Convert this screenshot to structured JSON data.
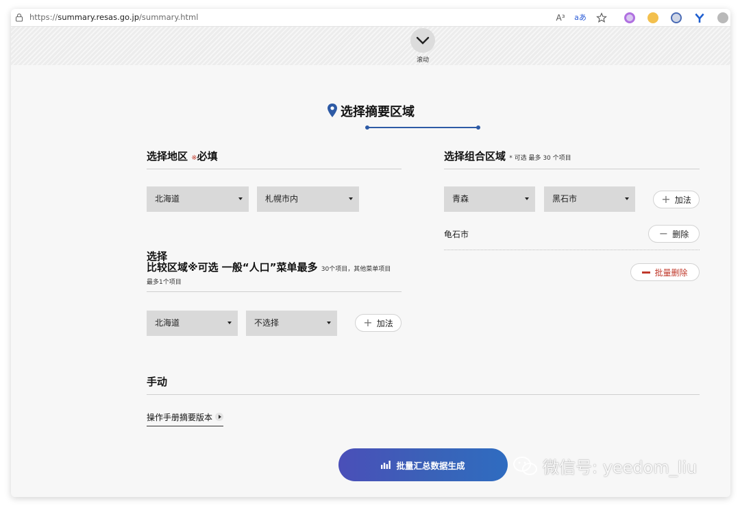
{
  "browser": {
    "url_prefix": "https://",
    "url_host": "summary.resas.go.jp",
    "url_path": "/summary.html",
    "read_aloud_icon": "A³",
    "translate_icon": "aあ"
  },
  "scroll": {
    "label": "滚动"
  },
  "page_title": "选择摘要区域",
  "region": {
    "heading": "选择地区",
    "required_mark": "※",
    "required": "必填",
    "prefecture": "北海道",
    "city": "札幌市内"
  },
  "combo": {
    "heading": "选择组合区域",
    "note": "* 可选 最多 30 个项目",
    "prefecture": "青森",
    "city": "黑石市",
    "add_label": "加法",
    "items": [
      {
        "name": "龟石市",
        "delete_label": "删除"
      }
    ],
    "bulk_delete_label": "批量删除"
  },
  "compare": {
    "heading_line1": "选择",
    "heading_line2": "比较区域※可选 一般“人口”菜单最多",
    "note_inline": "30个项目，其他菜单项目",
    "note_line2": "最多1个项目",
    "prefecture": "北海道",
    "city": "不选择",
    "add_label": "加法"
  },
  "manual": {
    "heading": "手动",
    "link": "操作手册摘要版本"
  },
  "generate_label": "批量汇总数据生成",
  "watermark": "微信号: yeedom_liu",
  "colors": {
    "accent": "#2d5aa5",
    "danger": "#c0392b",
    "select_bg": "#d9d9d9"
  }
}
